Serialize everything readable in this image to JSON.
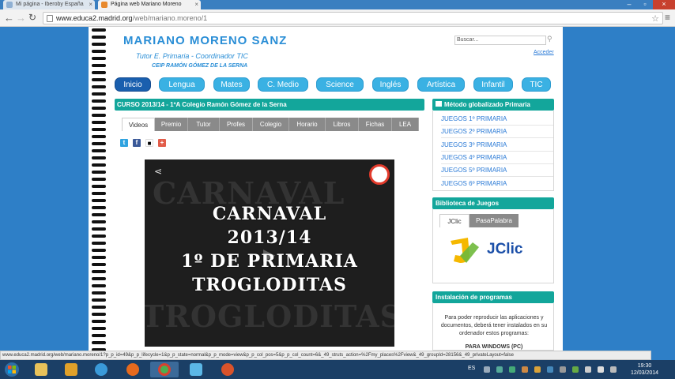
{
  "browser": {
    "tabs": [
      {
        "title": "Mi página - Iberoby España",
        "active": false
      },
      {
        "title": "Página web Mariano Moreno",
        "active": true
      }
    ],
    "url_host": "www.educa2.madrid.org",
    "url_path": "/web/mariano.moreno/1",
    "status_url": "www.educa2.madrid.org/web/mariano.moreno/1?p_p_id=49&p_p_lifecycle=1&p_p_state=normal&p_p_mode=view&p_p_col_pos=5&p_p_col_count=6&_49_struts_action=%2Fmy_places%2Fview&_49_groupId=28156&_49_privateLayout=false"
  },
  "header": {
    "title": "MARIANO MORENO SANZ",
    "subtitle": "Tutor E. Primaria - Coordinador TIC",
    "school": "CEIP RAMÓN GÓMEZ DE LA SERNA",
    "search_placeholder": "Buscar...",
    "login": "Acceder"
  },
  "nav": [
    "Inicio",
    "Lengua",
    "Mates",
    "C. Medio",
    "Science",
    "Inglés",
    "Artística",
    "Infantil",
    "TIC"
  ],
  "main": {
    "panel_title": "CURSO 2013/14 - 1ºA Colegio Ramón Gómez de la Serna",
    "tabs": [
      "Videos",
      "Premio",
      "Tutor",
      "Profes",
      "Colegio",
      "Horario",
      "Libros",
      "Fichas",
      "LEA"
    ],
    "video": {
      "lines": [
        "CARNAVAL",
        "2013/14",
        "1º DE PRIMARIA",
        "TROGLODITAS"
      ],
      "bg_words": [
        "CARNAVAL",
        "TROGLODITAS"
      ]
    }
  },
  "right": {
    "box1_title": "Método globalizado Primaria",
    "games": [
      "JUEGOS 1º PRIMARIA",
      "JUEGOS 2º PRIMARIA",
      "JUEGOS 3º PRIMARIA",
      "JUEGOS 4º PRIMARIA",
      "JUEGOS 5º PRIMARIA",
      "JUEGOS 6º PRIMARIA"
    ],
    "box2_title": "Biblioteca de Juegos",
    "box2_tabs": [
      "JClic",
      "PasaPalabra"
    ],
    "jclic_logo_text": "JClic",
    "box3_title": "Instalación de programas",
    "box3_text": "Para poder reproducir las aplicaciones y documentos, deberá tener instalados en su ordenador estos programas:",
    "box3_sub": "PARA WINDOWS (PC)"
  },
  "taskbar": {
    "lang": "ES",
    "time": "19:30",
    "date": "12/03/2014"
  },
  "colors": {
    "accent_teal": "#13a69b",
    "nav_blue": "#3ab1e3",
    "nav_active": "#1a5fae"
  }
}
